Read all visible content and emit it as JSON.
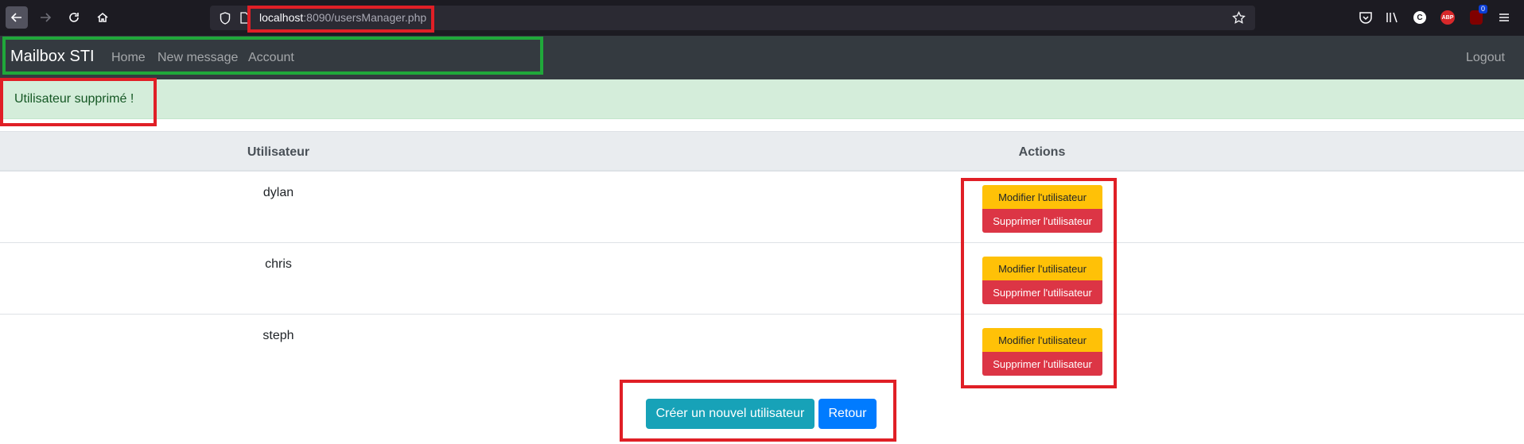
{
  "browser": {
    "url_host": "localhost",
    "url_rest": ":8090/usersManager.php",
    "ublock_count": "0",
    "abp_label": "ABP",
    "c_label": "C"
  },
  "navbar": {
    "brand": "Mailbox STI",
    "links": [
      "Home",
      "New message",
      "Account"
    ],
    "logout": "Logout"
  },
  "alert": {
    "message": "Utilisateur supprimé !"
  },
  "table": {
    "headers": [
      "Utilisateur",
      "Actions"
    ],
    "rows": [
      {
        "username": "dylan",
        "edit": "Modifier l'utilisateur",
        "delete": "Supprimer l'utilisateur"
      },
      {
        "username": "chris",
        "edit": "Modifier l'utilisateur",
        "delete": "Supprimer l'utilisateur"
      },
      {
        "username": "steph",
        "edit": "Modifier l'utilisateur",
        "delete": "Supprimer l'utilisateur"
      }
    ]
  },
  "footer_buttons": {
    "create": "Créer un nouvel utilisateur",
    "back": "Retour"
  },
  "colors": {
    "navbar_bg": "#343a40",
    "alert_bg": "#d4edda",
    "edit_btn": "#ffc107",
    "delete_btn": "#dc3545",
    "create_btn": "#17a2b8",
    "back_btn": "#007bff",
    "annotation_red": "#e01f26",
    "annotation_green": "#20a83a"
  }
}
